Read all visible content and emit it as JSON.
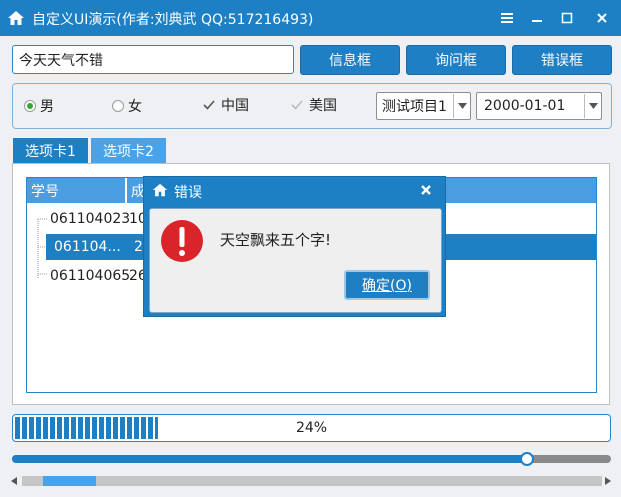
{
  "window": {
    "title": "自定义UI演示(作者:刘典武 QQ:517216493)"
  },
  "toolbar": {
    "text_value": "今天天气不错",
    "info_button": "信息框",
    "ask_button": "询问框",
    "error_button": "错误框"
  },
  "options": {
    "radio_male": "男",
    "radio_female": "女",
    "check_china": "中国",
    "check_usa": "美国",
    "combo_project": "测试项目1",
    "combo_date": "2000-01-01"
  },
  "tabs": [
    {
      "label": "选项卡1"
    },
    {
      "label": "选项卡2"
    }
  ],
  "table": {
    "headers": [
      "学号",
      "成"
    ],
    "rows": [
      {
        "id": "061104023",
        "score": "10"
      },
      {
        "id": "061104...",
        "score": "2"
      },
      {
        "id": "061104065",
        "score": "26"
      }
    ]
  },
  "dialog": {
    "title": "错误",
    "message": "天空飘来五个字!",
    "ok_button": "确定(O)"
  },
  "progress": {
    "value": 24,
    "label": "24%"
  },
  "slider": {
    "value": 0.86
  },
  "colors": {
    "accent": "#1e80c4",
    "selected_row": "#1e80c4",
    "error_red": "#d9242a"
  }
}
